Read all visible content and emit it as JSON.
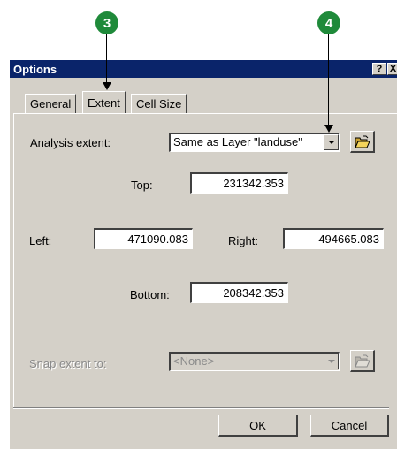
{
  "callouts": {
    "step1": "3",
    "step2": "4"
  },
  "dialog": {
    "title": "Options",
    "help_button": "?",
    "close_button": "X"
  },
  "tabs": [
    {
      "label": "General",
      "active": false
    },
    {
      "label": "Extent",
      "active": true
    },
    {
      "label": "Cell Size",
      "active": false
    }
  ],
  "extent": {
    "analysis_label": "Analysis extent:",
    "analysis_value": "Same as Layer \"landuse\"",
    "top_label": "Top:",
    "top_value": "231342.353",
    "left_label": "Left:",
    "left_value": "471090.083",
    "right_label": "Right:",
    "right_value": "494665.083",
    "bottom_label": "Bottom:",
    "bottom_value": "208342.353",
    "snap_label": "Snap extent to:",
    "snap_value": "<None>"
  },
  "buttons": {
    "ok": "OK",
    "cancel": "Cancel"
  },
  "icons": {
    "browse": "open-folder-icon",
    "dropdown": "chevron-down-icon"
  },
  "colors": {
    "titlebar": "#0a246a",
    "dialog_face": "#d4d0c8",
    "callout": "#1f8a3a"
  }
}
